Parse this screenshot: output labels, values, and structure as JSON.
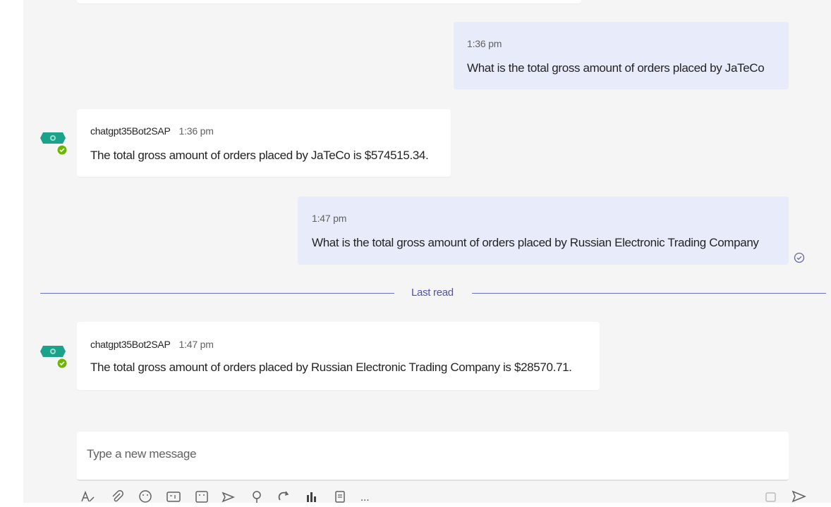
{
  "messages": [
    {
      "from": "me",
      "time": "1:36 pm",
      "text": "What is the total gross amount of orders placed by JaTeCo"
    },
    {
      "from": "bot",
      "sender": "chatgpt35Bot2SAP",
      "time": "1:36 pm",
      "text": "The total gross amount of orders placed by JaTeCo is $574515.34."
    },
    {
      "from": "me",
      "time": "1:47 pm",
      "text": "What is the total gross amount of orders placed by Russian Electronic Trading Company"
    },
    {
      "from": "bot",
      "sender": "chatgpt35Bot2SAP",
      "time": "1:47 pm",
      "text": "The total gross amount of orders placed by Russian Electronic Trading Company is $28570.71."
    }
  ],
  "divider": {
    "label": "Last read"
  },
  "composer": {
    "placeholder": "Type a new message"
  },
  "toolbar": {
    "more_label": "..."
  },
  "colors": {
    "accent": "#6264a7",
    "bot_avatar": "#1aa38a",
    "presence": "#6bb700",
    "my_bubble": "#e8ebfa"
  }
}
